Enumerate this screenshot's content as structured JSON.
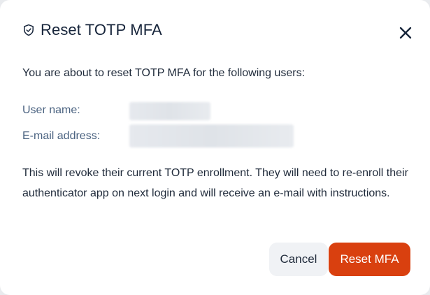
{
  "dialog": {
    "title": "Reset TOTP MFA",
    "title_icon": "shield-check-icon",
    "close_icon": "close-icon",
    "intro": "You are about to reset TOTP MFA for the following users:",
    "fields": {
      "username_label": "User name:",
      "email_label": "E-mail address:"
    },
    "description": "This will revoke their current TOTP enrollment. They will need to re-enroll their authenticator app on next login and will receive an e-mail with instructions.",
    "buttons": {
      "cancel_label": "Cancel",
      "confirm_label": "Reset MFA"
    },
    "colors": {
      "confirm_bg": "#d9400f",
      "title": "#16243a",
      "label": "#4a6280"
    }
  }
}
